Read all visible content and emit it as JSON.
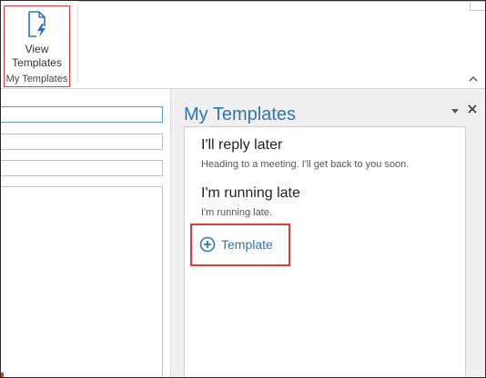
{
  "ribbon": {
    "view_templates_label_line1": "View",
    "view_templates_label_line2": "Templates",
    "group_label": "My Templates",
    "collapse_icon": "chevron-up-icon"
  },
  "pane": {
    "title": "My Templates",
    "options_icon": "triangle-down-icon",
    "close_icon": "close-icon",
    "templates": [
      {
        "title": "I'll reply later",
        "body": "Heading to a meeting. I'll get back to you soon."
      },
      {
        "title": "I'm running late",
        "body": "I'm running late."
      }
    ],
    "add_template_label": "Template",
    "add_icon": "plus-circle-icon"
  },
  "colors": {
    "accent": "#2e75b6",
    "highlight": "#e23a3a"
  }
}
